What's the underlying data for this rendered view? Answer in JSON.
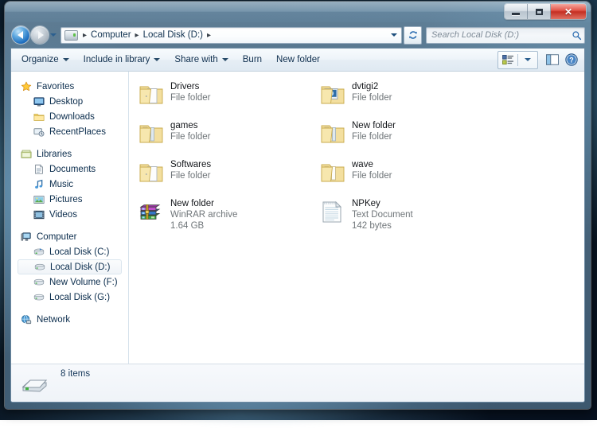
{
  "window": {
    "controls": {
      "minimize_label": "–",
      "maximize_label": "□",
      "close_label": "✕"
    }
  },
  "addressbar": {
    "back_tooltip": "Back",
    "forward_tooltip": "Forward",
    "breadcrumb": [
      {
        "label": "Computer"
      },
      {
        "label": "Local Disk (D:)"
      }
    ],
    "separator": "▸",
    "refresh_label": "↻"
  },
  "search": {
    "placeholder": "Search Local Disk (D:)",
    "value": ""
  },
  "toolbar": {
    "items": [
      {
        "label": "Organize",
        "has_caret": true
      },
      {
        "label": "Include in library",
        "has_caret": true
      },
      {
        "label": "Share with",
        "has_caret": true
      },
      {
        "label": "Burn",
        "has_caret": false
      },
      {
        "label": "New folder",
        "has_caret": false
      }
    ],
    "view_button": "change-view-button",
    "view_caret": "view-dropdown-caret",
    "preview_button": "show-preview-pane-button",
    "help_button": "help-button"
  },
  "navpane": {
    "groups": [
      {
        "header": {
          "label": "Favorites",
          "icon": "star-icon"
        },
        "items": [
          {
            "label": "Desktop",
            "icon": "desktop-icon"
          },
          {
            "label": "Downloads",
            "icon": "downloads-folder-icon"
          },
          {
            "label": "RecentPlaces",
            "icon": "recent-places-icon"
          }
        ]
      },
      {
        "header": {
          "label": "Libraries",
          "icon": "libraries-icon"
        },
        "items": [
          {
            "label": "Documents",
            "icon": "documents-icon"
          },
          {
            "label": "Music",
            "icon": "music-icon"
          },
          {
            "label": "Pictures",
            "icon": "pictures-icon"
          },
          {
            "label": "Videos",
            "icon": "videos-icon"
          }
        ]
      },
      {
        "header": {
          "label": "Computer",
          "icon": "computer-icon"
        },
        "items": [
          {
            "label": "Local Disk (C:)",
            "icon": "system-drive-icon",
            "selected": false
          },
          {
            "label": "Local Disk (D:)",
            "icon": "drive-icon",
            "selected": true
          },
          {
            "label": "New Volume (F:)",
            "icon": "drive-icon",
            "selected": false
          },
          {
            "label": "Local Disk (G:)",
            "icon": "drive-icon",
            "selected": false
          }
        ]
      },
      {
        "header": {
          "label": "Network",
          "icon": "network-icon"
        },
        "items": []
      }
    ]
  },
  "files": [
    {
      "name": "Drivers",
      "type": "File folder",
      "size": "",
      "icon": "folder-open-icon"
    },
    {
      "name": "dvtigi2",
      "type": "File folder",
      "size": "",
      "icon": "folder-media-icon"
    },
    {
      "name": "games",
      "type": "File folder",
      "size": "",
      "icon": "folder-files-icon"
    },
    {
      "name": "New folder",
      "type": "File folder",
      "size": "",
      "icon": "folder-files-icon"
    },
    {
      "name": "Softwares",
      "type": "File folder",
      "size": "",
      "icon": "folder-open-icon"
    },
    {
      "name": "wave",
      "type": "File folder",
      "size": "",
      "icon": "folder-files-icon"
    },
    {
      "name": "New folder",
      "type": "WinRAR archive",
      "size": "1.64 GB",
      "icon": "winrar-archive-icon"
    },
    {
      "name": "NPKey",
      "type": "Text Document",
      "size": "142 bytes",
      "icon": "text-document-icon"
    }
  ],
  "statusbar": {
    "item_count": "8 items",
    "icon": "hard-drive-icon"
  },
  "colors": {
    "accent_blue": "#1f6fc0",
    "folder_yellow": "#f6e3a0",
    "close_red": "#c42f22",
    "text_dark": "#13161a",
    "text_muted": "#6f7579"
  }
}
